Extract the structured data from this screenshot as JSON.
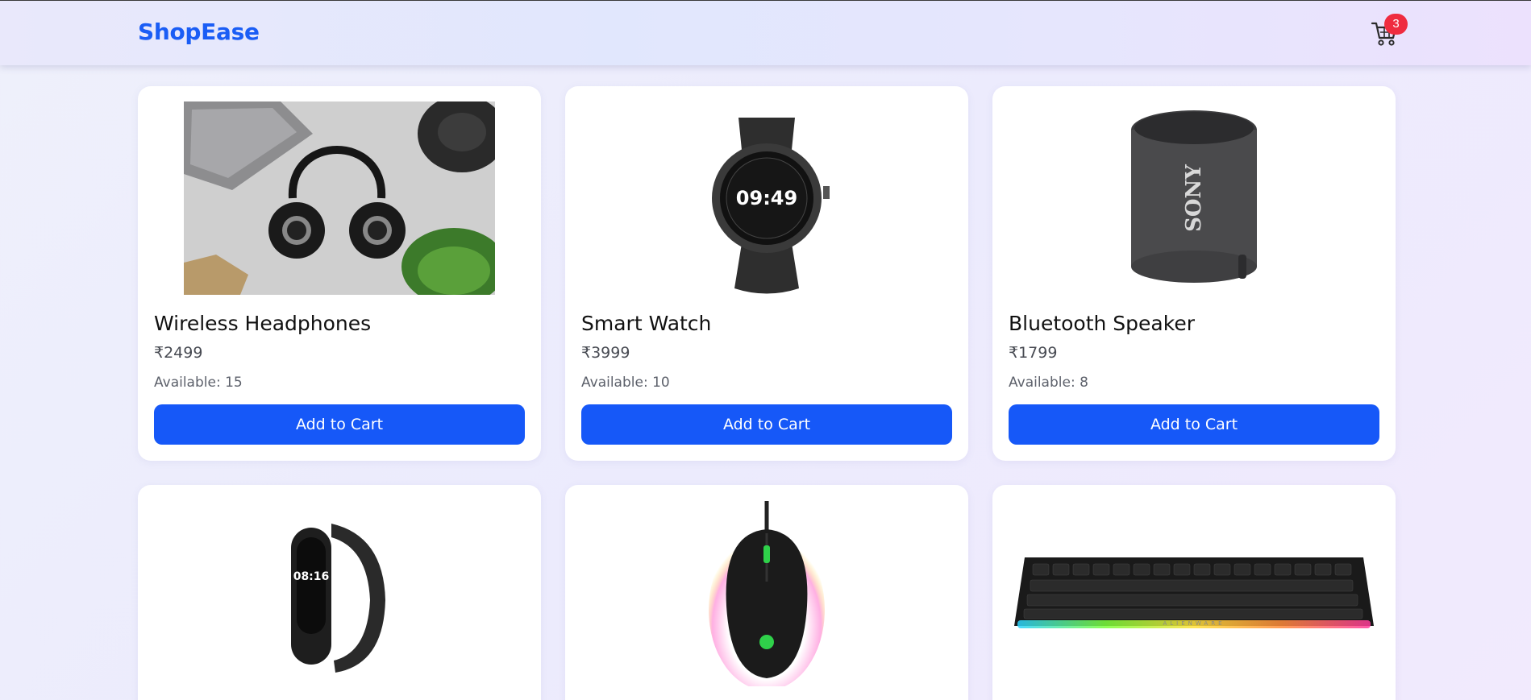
{
  "header": {
    "brand": "ShopEase",
    "cart_count": "3"
  },
  "products": [
    {
      "name": "Wireless Headphones",
      "price": "₹2499",
      "available": "Available: 15",
      "button": "Add to Cart",
      "image_icon": "headphones-image"
    },
    {
      "name": "Smart Watch",
      "price": "₹3999",
      "available": "Available: 10",
      "button": "Add to Cart",
      "image_icon": "smartwatch-image"
    },
    {
      "name": "Bluetooth Speaker",
      "price": "₹1799",
      "available": "Available: 8",
      "button": "Add to Cart",
      "image_icon": "speaker-image",
      "image_text": "SONY"
    },
    {
      "image_icon": "fitness-band-image"
    },
    {
      "image_icon": "gaming-mouse-image"
    },
    {
      "image_icon": "keyboard-image",
      "image_text": "ALIENWARE"
    }
  ],
  "colors": {
    "brand": "#1a5df5",
    "button": "#1658f8",
    "badge": "#ef2b3f"
  }
}
